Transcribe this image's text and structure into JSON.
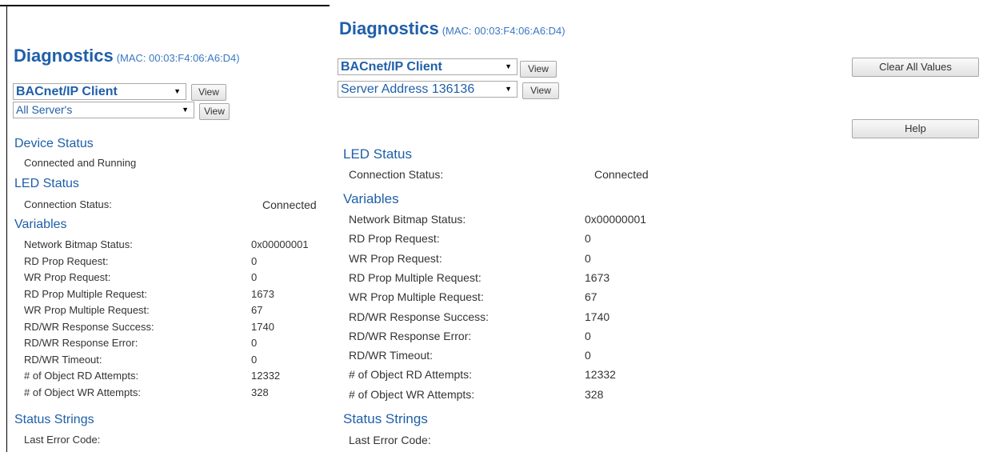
{
  "left": {
    "title": "Diagnostics",
    "mac": "(MAC: 00:03:F4:06:A6:D4)",
    "protocol_select": "BACnet/IP Client",
    "server_select": "All Server's",
    "view_label": "View",
    "device_status": {
      "heading": "Device Status",
      "text": "Connected and Running"
    },
    "led_status": {
      "heading": "LED Status",
      "connection_label": "Connection Status:",
      "connection_value": "Connected"
    },
    "variables": {
      "heading": "Variables",
      "rows": [
        {
          "label": "Network Bitmap Status:",
          "value": "0x00000001"
        },
        {
          "label": "RD Prop Request:",
          "value": "0"
        },
        {
          "label": "WR Prop Request:",
          "value": "0"
        },
        {
          "label": "RD Prop Multiple Request:",
          "value": "1673"
        },
        {
          "label": "WR Prop Multiple Request:",
          "value": "67"
        },
        {
          "label": "RD/WR Response Success:",
          "value": "1740"
        },
        {
          "label": "RD/WR Response Error:",
          "value": "0"
        },
        {
          "label": "RD/WR Timeout:",
          "value": "0"
        },
        {
          "label": "# of Object RD Attempts:",
          "value": "12332"
        },
        {
          "label": "# of Object WR Attempts:",
          "value": "328"
        }
      ]
    },
    "status_strings": {
      "heading": "Status Strings",
      "last_error_label": "Last Error Code:"
    }
  },
  "right": {
    "title": "Diagnostics",
    "mac": "(MAC: 00:03:F4:06:A6:D4)",
    "protocol_select": "BACnet/IP Client",
    "server_select": "Server Address 136136",
    "view_label": "View",
    "clear_all_label": "Clear All Values",
    "help_label": "Help",
    "led_status": {
      "heading": "LED Status",
      "connection_label": "Connection Status:",
      "connection_value": "Connected"
    },
    "variables": {
      "heading": "Variables",
      "rows": [
        {
          "label": "Network Bitmap Status:",
          "value": "0x00000001"
        },
        {
          "label": "RD Prop Request:",
          "value": "0"
        },
        {
          "label": "WR Prop Request:",
          "value": "0"
        },
        {
          "label": "RD Prop Multiple Request:",
          "value": "1673"
        },
        {
          "label": "WR Prop Multiple Request:",
          "value": "67"
        },
        {
          "label": "RD/WR Response Success:",
          "value": "1740"
        },
        {
          "label": "RD/WR Response Error:",
          "value": "0"
        },
        {
          "label": "RD/WR Timeout:",
          "value": "0"
        },
        {
          "label": "# of Object RD Attempts:",
          "value": "12332"
        },
        {
          "label": "# of Object WR Attempts:",
          "value": "328"
        }
      ]
    },
    "status_strings": {
      "heading": "Status Strings",
      "last_error_label": "Last Error Code:"
    }
  }
}
